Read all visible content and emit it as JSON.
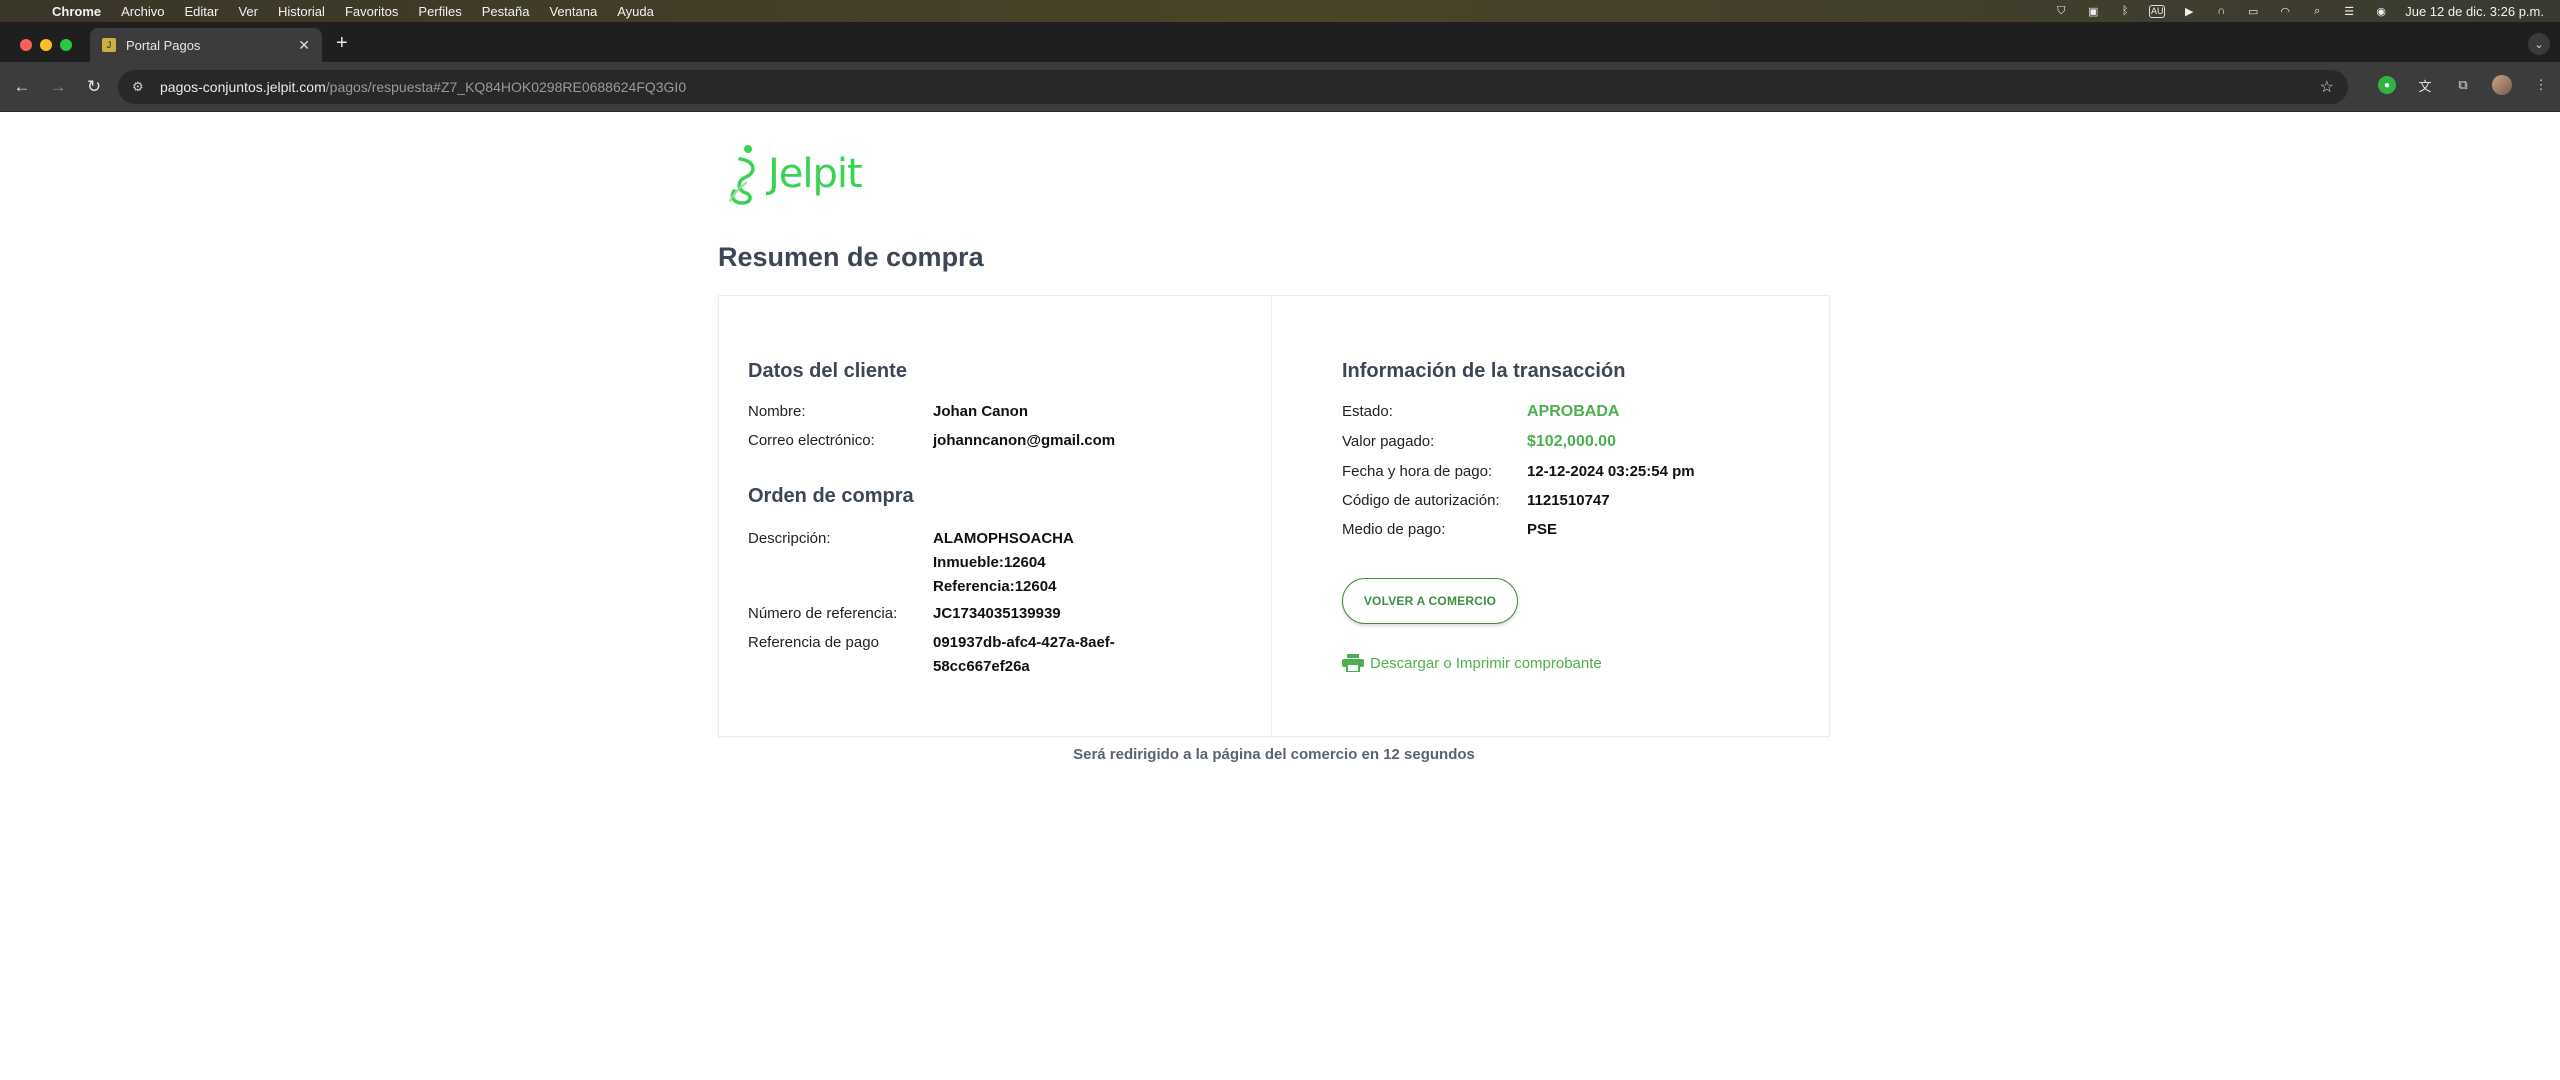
{
  "menubar": {
    "items": [
      "Chrome",
      "Archivo",
      "Editar",
      "Ver",
      "Historial",
      "Favoritos",
      "Perfiles",
      "Pestaña",
      "Ventana",
      "Ayuda"
    ],
    "kbd": "AU",
    "datetime": "Jue 12 de dic.  3:26 p.m."
  },
  "browser": {
    "tab_title": "Portal Pagos",
    "url_host": "pagos-conjuntos.jelpit.com",
    "url_path": "/pagos/respuesta#Z7_KQ84HOK0298RE0688624FQ3GI0"
  },
  "page": {
    "brand": "Jelpit",
    "title": "Resumen de compra",
    "cliente": {
      "title": "Datos del cliente",
      "nombre_label": "Nombre:",
      "nombre_value": "Johan Canon",
      "correo_label": "Correo electrónico:",
      "correo_value": "johanncanon@gmail.com"
    },
    "orden": {
      "title": "Orden de compra",
      "descripcion_label": "Descripción:",
      "descripcion_lines": [
        "ALAMOPHSOACHA",
        "Inmueble:12604",
        "Referencia:12604"
      ],
      "num_ref_label": "Número de referencia:",
      "num_ref_value": "JC1734035139939",
      "ref_pago_label": "Referencia de pago",
      "ref_pago_lines": [
        "091937db-afc4-427a-8aef-",
        "58cc667ef26a"
      ]
    },
    "transaccion": {
      "title": "Información de la transacción",
      "estado_label": "Estado:",
      "estado_value": "APROBADA",
      "valor_label": "Valor pagado:",
      "valor_value": "$102,000.00",
      "fecha_label": "Fecha y hora de pago:",
      "fecha_value": "12-12-2024 03:25:54 pm",
      "codigo_label": "Código de autorización:",
      "codigo_value": "1121510747",
      "medio_label": "Medio de pago:",
      "medio_value": "PSE"
    },
    "volver_label": "VOLVER A COMERCIO",
    "print_label": "Descargar o Imprimir comprobante",
    "redirect_msg": "Será redirigido a la página del comercio en 12 segundos"
  },
  "colors": {
    "brand_green": "#39d353",
    "approved_green": "#4caf50",
    "heading": "#3d4656"
  }
}
